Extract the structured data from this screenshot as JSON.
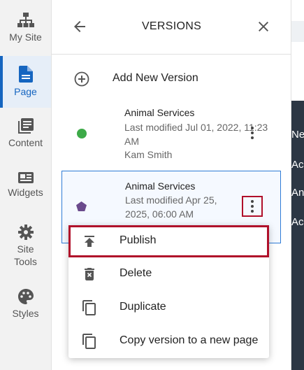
{
  "sidebar": {
    "items": [
      {
        "label": "My Site",
        "icon": "sitemap-icon"
      },
      {
        "label": "Page",
        "icon": "page-icon",
        "active": true
      },
      {
        "label": "Content",
        "icon": "content-library-icon"
      },
      {
        "label": "Widgets",
        "icon": "widgets-icon"
      },
      {
        "label": "Site\nTools",
        "icon": "gear-icon"
      },
      {
        "label": "Styles",
        "icon": "palette-icon"
      }
    ]
  },
  "panel": {
    "title": "VERSIONS",
    "add_label": "Add New Version"
  },
  "versions": [
    {
      "name": "Animal Services",
      "meta_line1": "Last modified Jul 01, 2022, 11:23",
      "meta_line2": "AM",
      "author": "Kam Smith",
      "status_color": "#3daa48",
      "status_shape": "circle"
    },
    {
      "name": "Animal Services",
      "meta_line1": "Last modified Apr 25,",
      "meta_line2": "2025, 06:00 AM",
      "status_color": "#6a4a8c",
      "status_shape": "pentagon",
      "selected": true
    }
  ],
  "menu": {
    "items": [
      {
        "label": "Publish",
        "icon": "publish-icon",
        "highlighted": true
      },
      {
        "label": "Delete",
        "icon": "trash-icon"
      },
      {
        "label": "Duplicate",
        "icon": "duplicate-icon"
      },
      {
        "label": "Copy version to a new page",
        "icon": "copy-icon"
      }
    ]
  },
  "background_fragments": [
    "Ne",
    "Ac",
    "An",
    "Ac"
  ],
  "colors": {
    "accent": "#1565c0",
    "highlight_box": "#b0102a",
    "dark_background": "#2c3744"
  }
}
